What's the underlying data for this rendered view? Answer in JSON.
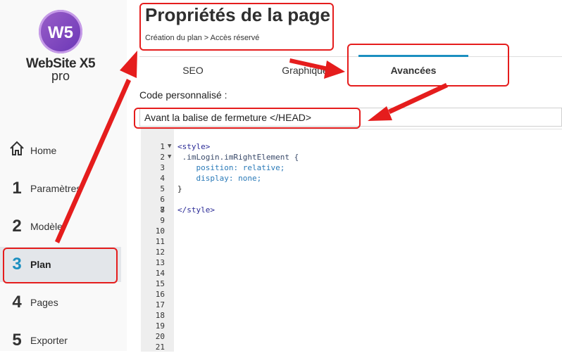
{
  "logo": {
    "mark": "W5",
    "name": "WebSite X5",
    "edition": "pro"
  },
  "sidebar": {
    "items": [
      {
        "num": "",
        "icon": "home-icon",
        "label": "Home"
      },
      {
        "num": "1",
        "label": "Paramètres"
      },
      {
        "num": "2",
        "label": "Modèle"
      },
      {
        "num": "3",
        "label": "Plan",
        "active": true
      },
      {
        "num": "4",
        "label": "Pages"
      },
      {
        "num": "5",
        "label": "Exporter"
      }
    ]
  },
  "header": {
    "title": "Propriétés de la page",
    "breadcrumb": "Création du plan > Accès réservé"
  },
  "tabs": [
    {
      "label": "SEO"
    },
    {
      "label": "Graphique"
    },
    {
      "label": "Avancées",
      "active": true
    }
  ],
  "custom_code": {
    "label": "Code personnalisé :",
    "position_value": "Avant la balise de fermeture </HEAD>"
  },
  "editor": {
    "line_numbers": [
      "1",
      "2",
      "3",
      "4",
      "5",
      "6",
      "7",
      "8",
      "9",
      "10",
      "11",
      "12",
      "13",
      "14",
      "15",
      "16",
      "17",
      "18",
      "19",
      "20",
      "21"
    ],
    "lines": [
      "<style>",
      " .imLogin.imRightElement {",
      "    position: relative;",
      "    display: none;",
      "}",
      "",
      "</style>"
    ]
  },
  "colors": {
    "accent": "#1b8fc0",
    "annotation": "#e51d1d",
    "logo_purple": "#7a45c0"
  }
}
